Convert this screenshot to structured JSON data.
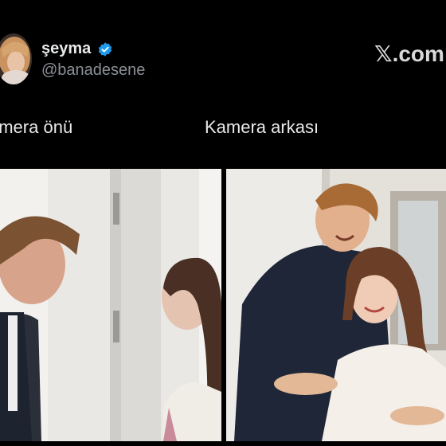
{
  "post": {
    "author": {
      "display_name": "şeyma",
      "handle": "@banadesene",
      "verified": true,
      "avatar_icon": "profile-photo"
    },
    "platform_logo": {
      "text": ".com",
      "icon": "x-logo-icon"
    },
    "captions": {
      "left": "amera önü",
      "right": "Kamera arkası"
    },
    "images": {
      "left_icon": "photo-before-camera",
      "right_icon": "photo-behind-camera"
    }
  },
  "colors": {
    "background": "#000000",
    "text": "#e7e9ea",
    "handle": "#8b9096",
    "verified_badge": "#1d9bf0"
  }
}
